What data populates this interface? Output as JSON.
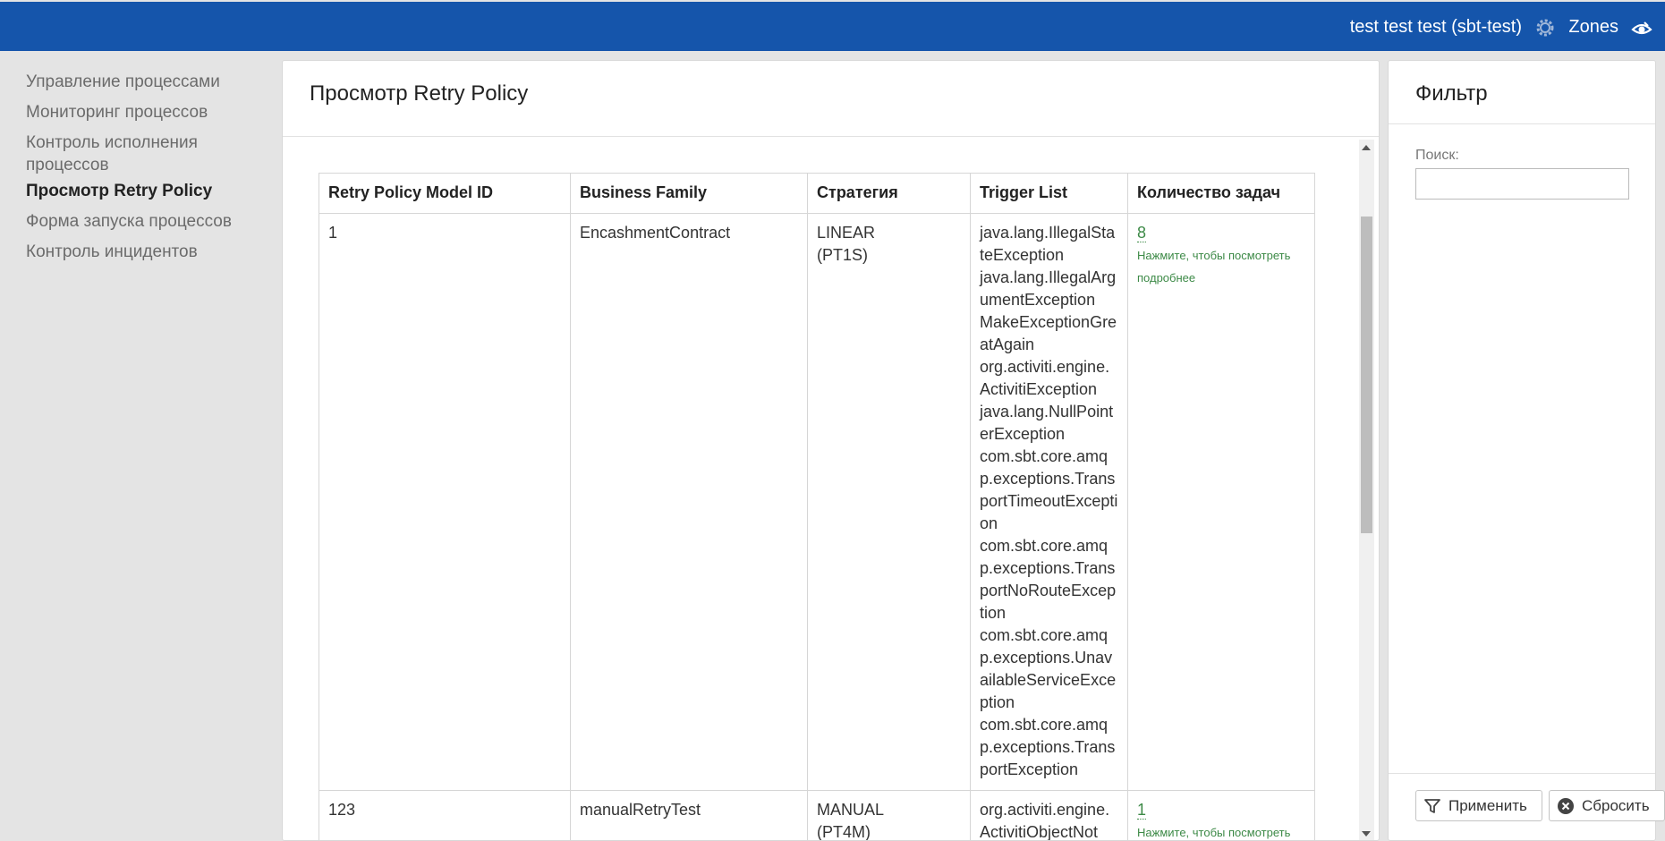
{
  "header": {
    "user": "test test test (sbt-test)",
    "zones_label": "Zones",
    "icons": [
      "gear-icon",
      "eye-icon"
    ],
    "bg_color": "#1555ab"
  },
  "sidebar": {
    "items": [
      {
        "label": "Управление процессами"
      },
      {
        "label": "Мониторинг процессов"
      },
      {
        "label": "Контроль исполнения процессов"
      },
      {
        "label": "Просмотр Retry Policy",
        "active": true
      },
      {
        "label": "Форма запуска процессов"
      },
      {
        "label": "Контроль инцидентов"
      }
    ]
  },
  "main": {
    "title": "Просмотр Retry Policy",
    "table": {
      "columns": [
        "Retry Policy Model ID",
        "Business Family",
        "Стратегия",
        "Trigger List",
        "Количество задач"
      ],
      "rows": [
        {
          "id": "1",
          "family": "EncashmentContract",
          "strategy": "LINEAR",
          "strategy_param": "(PT1S)",
          "triggers": [
            "java.lang.IllegalStateException",
            "java.lang.IllegalArgumentException",
            "MakeExceptionGreatAgain",
            "org.activiti.engine.ActivitiException",
            "java.lang.NullPointerException",
            "com.sbt.core.amqp.exceptions.TransportTimeoutException",
            "com.sbt.core.amqp.exceptions.TransportNoRouteException",
            "com.sbt.core.amqp.exceptions.UnavailableServiceException",
            "com.sbt.core.amqp.exceptions.TransportException"
          ],
          "count": "8",
          "count_hint": "Нажмите, чтобы посмотреть подробнее"
        },
        {
          "id": "123",
          "family": "manualRetryTest",
          "strategy": "MANUAL",
          "strategy_param": "(PT4M)",
          "triggers": [
            "org.activiti.engine.ActivitiObjectNot"
          ],
          "count": "1",
          "count_hint": "Нажмите, чтобы посмотреть подробнее"
        }
      ]
    }
  },
  "filter": {
    "title": "Фильтр",
    "search_label": "Поиск:",
    "search_value": "",
    "apply_label": "Применить",
    "reset_label": "Сбросить",
    "icons": [
      "filter-icon",
      "close-circle-icon"
    ]
  }
}
